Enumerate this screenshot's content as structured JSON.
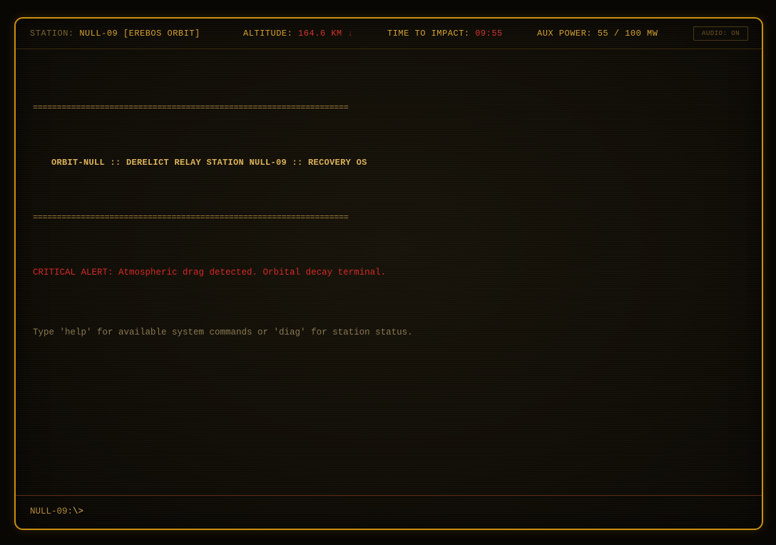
{
  "statusbar": {
    "station_label": "STATION:",
    "station_value": "NULL-09 [EREBOS ORBIT]",
    "altitude_label": "ALTITUDE:",
    "altitude_value": "164.6 KM",
    "altitude_arrow": "↓",
    "impact_label": "TIME TO IMPACT:",
    "impact_value": "09:55",
    "power_label": "AUX POWER:",
    "power_value": "55 / 100 MW",
    "audio_button": "AUDIO: ON"
  },
  "terminal": {
    "rule_top": "==================================================================",
    "header": "ORBIT-NULL :: DERELICT RELAY STATION NULL-09 :: RECOVERY OS",
    "rule_bottom": "==================================================================",
    "alert": "CRITICAL ALERT: Atmospheric drag detected. Orbital decay terminal.",
    "info": "Type 'help' for available system commands or 'diag' for station status."
  },
  "prompt": {
    "host": "NULL-09:",
    "path": "\\>",
    "input_value": ""
  },
  "colors": {
    "frame_border": "#c8900f",
    "amber_text": "#d4a032",
    "alert_red": "#d22a24",
    "dim_text": "#8a7850"
  }
}
